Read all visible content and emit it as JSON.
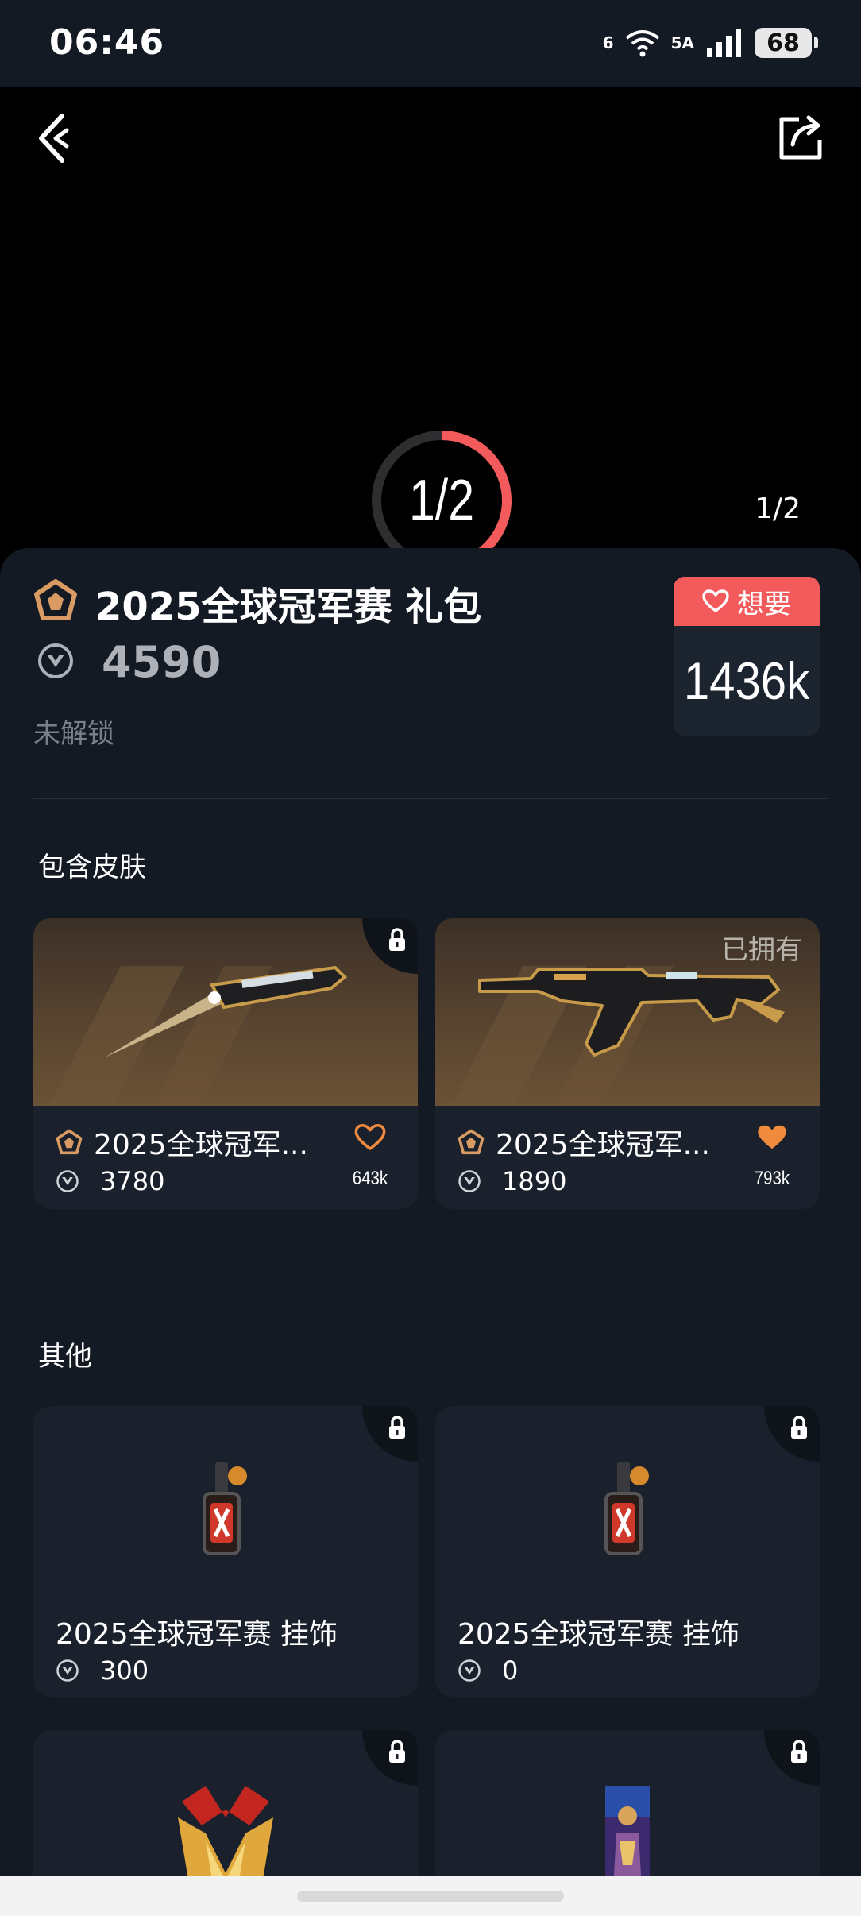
{
  "status_bar": {
    "time": "06:46",
    "wifi_label": "6",
    "network_label": "5A",
    "battery": "68"
  },
  "hero": {
    "ring_label": "1/2",
    "counter": "1/2",
    "progress_fraction": 0.5
  },
  "bundle": {
    "title": "2025全球冠军赛 礼包",
    "price": "4590",
    "unlock_status": "未解锁",
    "want_label": "想要",
    "want_count": "1436k"
  },
  "sections": {
    "skins_title": "包含皮肤",
    "other_title": "其他"
  },
  "skins": [
    {
      "name": "2025全球冠军...",
      "price": "3780",
      "likes": "643k",
      "liked": false,
      "locked": true,
      "owned_label": ""
    },
    {
      "name": "2025全球冠军...",
      "price": "1890",
      "likes": "793k",
      "liked": true,
      "locked": false,
      "owned_label": "已拥有"
    }
  ],
  "others": [
    {
      "name": "2025全球冠军赛 挂饰",
      "price": "300"
    },
    {
      "name": "2025全球冠军赛 挂饰",
      "price": "0"
    }
  ],
  "colors": {
    "accent_red": "#f25a5c",
    "heart_orange": "#f08a3c",
    "background": "#131a24"
  }
}
